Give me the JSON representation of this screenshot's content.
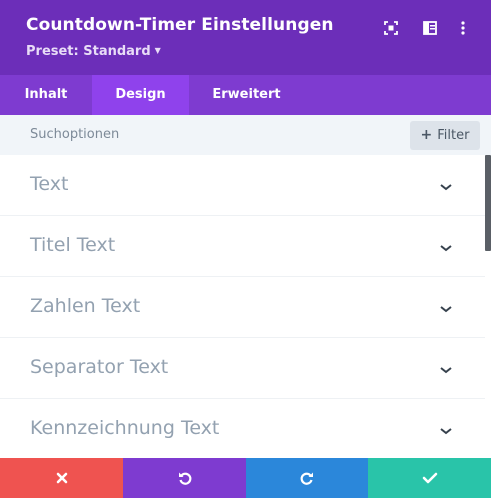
{
  "header": {
    "title": "Countdown-Timer Einstellungen",
    "preset": "Preset: Standard",
    "icons": [
      "focus-icon",
      "sidebar-layout-icon",
      "more-icon"
    ],
    "background": "#6c2eb9"
  },
  "tabs": [
    {
      "label": "Inhalt",
      "active": false
    },
    {
      "label": "Design",
      "active": true
    },
    {
      "label": "Erweitert",
      "active": false
    }
  ],
  "search": {
    "label": "Suchoptionen",
    "filter_label": "Filter"
  },
  "sections": [
    {
      "label": "Text"
    },
    {
      "label": "Titel Text"
    },
    {
      "label": "Zahlen Text"
    },
    {
      "label": "Separator Text"
    },
    {
      "label": "Kennzeichnung Text"
    }
  ],
  "footer": {
    "buttons": [
      {
        "name": "cancel",
        "icon": "close-icon",
        "color": "#ef5350"
      },
      {
        "name": "undo",
        "icon": "undo-icon",
        "color": "#7e3bd0"
      },
      {
        "name": "redo",
        "icon": "redo-icon",
        "color": "#2b87da"
      },
      {
        "name": "save",
        "icon": "check-icon",
        "color": "#29c4a9"
      }
    ]
  }
}
